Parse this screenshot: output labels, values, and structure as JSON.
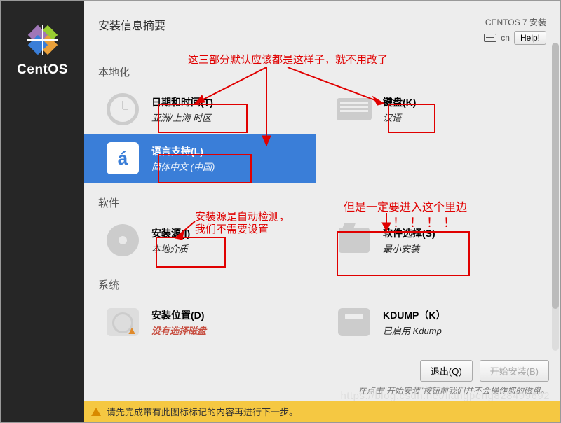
{
  "brand": "CentOS",
  "header": {
    "title": "安装信息摘要",
    "installer_label": "CENTOS 7 安装",
    "keyboard_layout": "cn",
    "help_label": "Help!"
  },
  "sections": {
    "localization": {
      "title": "本地化",
      "datetime": {
        "title": "日期和时间(T)",
        "status": "亚洲/上海 时区"
      },
      "keyboard": {
        "title": "键盘(K)",
        "status": "汉语"
      },
      "language": {
        "title": "语言支持(L)",
        "status": "简体中文 (中国)",
        "glyph": "á"
      }
    },
    "software": {
      "title": "软件",
      "source": {
        "title": "安装源(I)",
        "status": "本地介质"
      },
      "selection": {
        "title": "软件选择(S)",
        "status": "最小安装"
      }
    },
    "system": {
      "title": "系统",
      "destination": {
        "title": "安装位置(D)",
        "status": "没有选择磁盘"
      },
      "kdump": {
        "title": "KDUMP（K）",
        "status": "已启用 Kdump"
      }
    }
  },
  "footer": {
    "quit_label": "退出(Q)",
    "begin_label": "开始安装(B)",
    "hint": "在点击\"开始安装\"按钮前我们并不会操作您的磁盘。"
  },
  "warning_bar": "请先完成带有此图标标记的内容再进行下一步。",
  "annotations": {
    "top_note": "这三部分默认应该都是这样子，就不用改了",
    "source_note_l1": "安装源是自动检测，",
    "source_note_l2": "我们不需要设置",
    "software_note": "但是一定要进入这个里边",
    "software_bang": "！！！！"
  },
  "watermark": "https://blog.csdn.net/liangpeng828499692"
}
